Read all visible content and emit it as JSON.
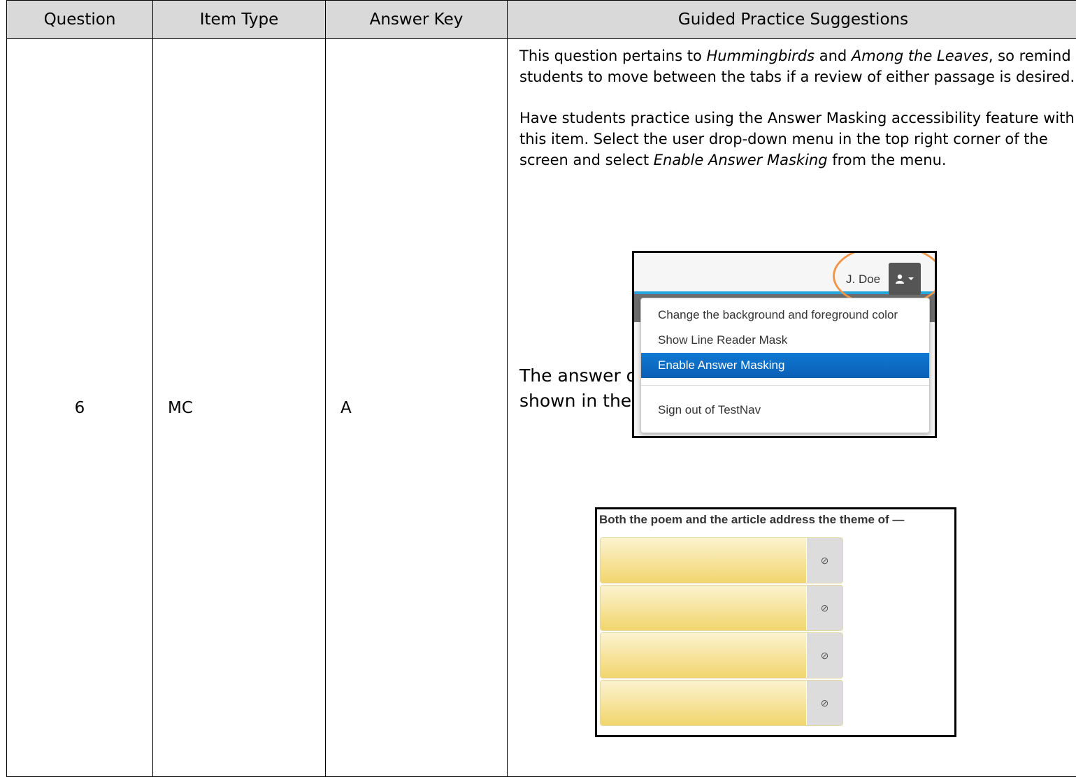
{
  "table": {
    "headers": [
      "Question",
      "Item Type",
      "Answer Key",
      "Guided Practice Suggestions"
    ],
    "row": {
      "question": "6",
      "item_type": "MC",
      "answer_key": "A",
      "guidance": {
        "p1_a": "This question pertains to ",
        "p1_title1": "Hummingbirds",
        "p1_and": " and ",
        "p1_title2": "Among the Leaves",
        "p1_b": ", so remind students to move between the tabs if a review of either passage is desired.",
        "p2_a": "Have students practice using the Answer Masking accessibility feature with this item. Select the user drop-down menu in the top right corner of the screen and select ",
        "p2_em": "Enable Answer Masking",
        "p2_b": " from the menu.",
        "p3": "The answer options will now be masked as shown in the screenshot."
      }
    }
  },
  "menu_screenshot": {
    "user_name": "J. Doe",
    "user_icon": "user-icon",
    "caret_icon": "caret-down-icon",
    "items": [
      "Change the background and foreground color",
      "Show Line Reader Mask",
      "Enable Answer Masking",
      "Sign out of TestNav"
    ],
    "highlight_color": "#f0964a",
    "selected_color": "#0a6fcf"
  },
  "mask_screenshot": {
    "stem": "Both the poem and the article address the theme of —",
    "options_count": 4,
    "mask_icon": "eye-slash-icon",
    "mask_color": "#f2d56e"
  }
}
